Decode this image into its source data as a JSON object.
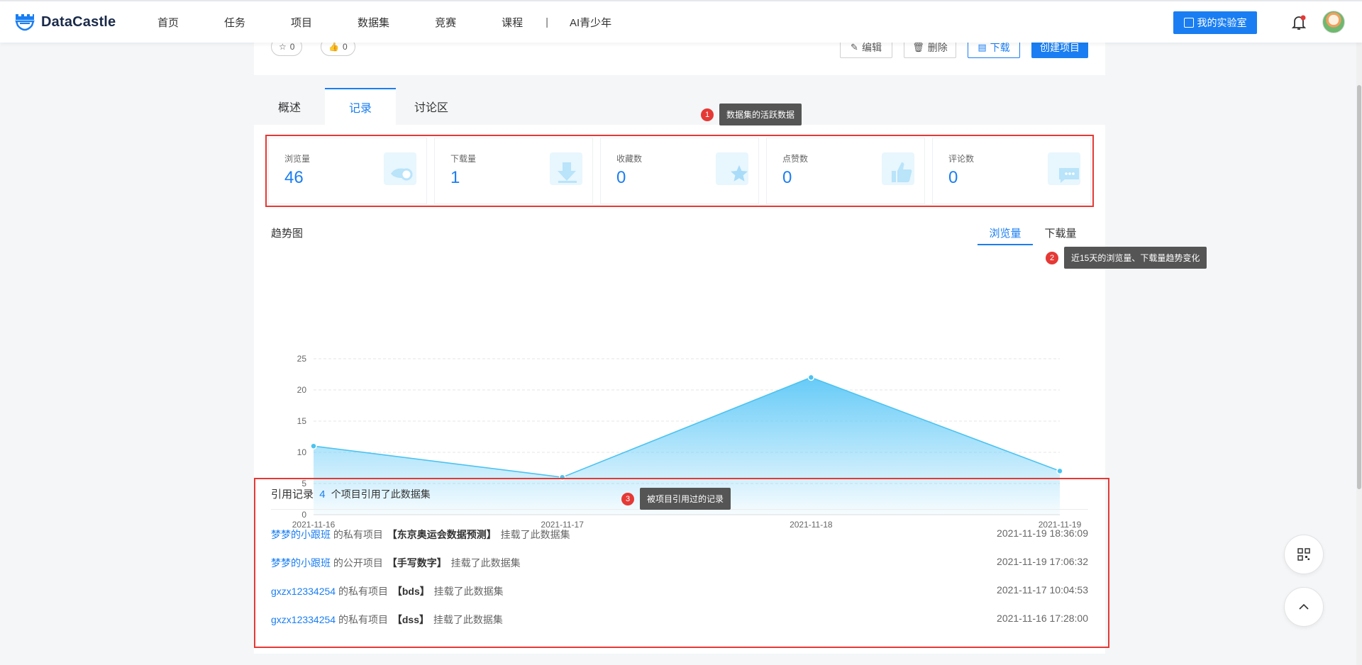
{
  "nav": {
    "logo_text": "DataCastle",
    "items": [
      "首页",
      "任务",
      "项目",
      "数据集",
      "竞赛",
      "课程"
    ],
    "separator": "|",
    "last_item": "AI青少年",
    "lab_button": "我的实验室"
  },
  "header": {
    "star_count": "0",
    "like_count": "0",
    "edit_label": "编辑",
    "delete_label": "删除",
    "download_label": "下载",
    "create_label": "创建项目"
  },
  "tabs": [
    "概述",
    "记录",
    "讨论区"
  ],
  "active_tab": "记录",
  "stats": [
    {
      "label": "浏览量",
      "value": "46",
      "icon": "eye-icon"
    },
    {
      "label": "下载量",
      "value": "1",
      "icon": "download-icon"
    },
    {
      "label": "收藏数",
      "value": "0",
      "icon": "star-icon"
    },
    {
      "label": "点赞数",
      "value": "0",
      "icon": "thumb-up-icon"
    },
    {
      "label": "评论数",
      "value": "0",
      "icon": "comment-icon"
    }
  ],
  "trend": {
    "title": "趋势图",
    "tab_views": "浏览量",
    "tab_downloads": "下载量"
  },
  "chart_data": {
    "type": "area",
    "x": [
      "2021-11-16",
      "2021-11-17",
      "2021-11-18",
      "2021-11-19"
    ],
    "series": [
      {
        "values": [
          11,
          6,
          22,
          7
        ]
      }
    ],
    "ylim": [
      0,
      25
    ],
    "yticks": [
      0,
      5,
      10,
      15,
      20,
      25
    ],
    "grid": true,
    "colors": {
      "line": "#4cc3f0",
      "fill": "#7fd0f7"
    }
  },
  "references": {
    "title": "引用记录",
    "count": "4",
    "suffix": "个项目引用了此数据集",
    "rows": [
      {
        "user": "梦梦的小跟班",
        "kind": "的私有项目",
        "project": "【东京奥运会数据预测】",
        "action": "挂载了此数据集",
        "time": "2021-11-19 18:36:09"
      },
      {
        "user": "梦梦的小跟班",
        "kind": "的公开项目",
        "project": "【手写数字】",
        "action": "挂载了此数据集",
        "time": "2021-11-19 17:06:32"
      },
      {
        "user": "gxzx12334254",
        "kind": "的私有项目",
        "project": "【bds】",
        "action": "挂载了此数据集",
        "time": "2021-11-17 10:04:53"
      },
      {
        "user": "gxzx12334254",
        "kind": "的私有项目",
        "project": "【dss】",
        "action": "挂载了此数据集",
        "time": "2021-11-16 17:28:00"
      }
    ]
  },
  "annotations": [
    {
      "num": "1",
      "text": "数据集的活跃数据"
    },
    {
      "num": "2",
      "text": "近15天的浏览量、下载量趋势变化"
    },
    {
      "num": "3",
      "text": "被项目引用过的记录"
    }
  ]
}
